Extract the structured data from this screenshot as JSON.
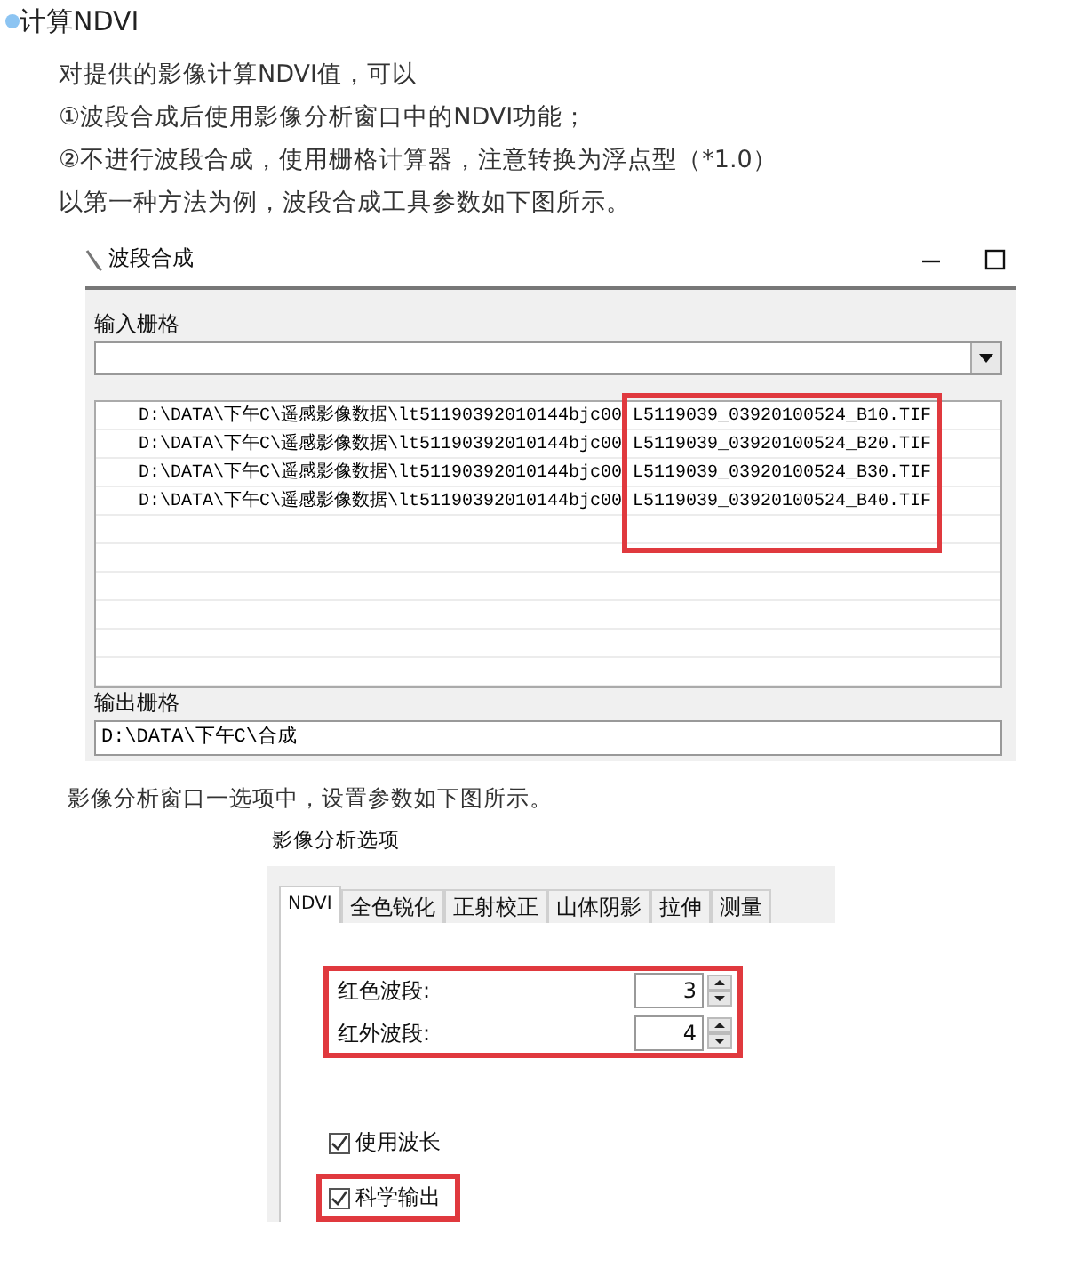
{
  "heading": {
    "text": "计算NDVI"
  },
  "paragraphs": [
    "对提供的影像计算NDVI值，可以",
    "①波段合成后使用影像分析窗口中的NDVI功能；",
    "②不进行波段合成，使用栅格计算器，注意转换为浮点型（*1.0）",
    "以第一种方法为例，波段合成工具参数如下图所示。"
  ],
  "band_window": {
    "title": "波段合成",
    "input_label": "输入栅格",
    "files_highlighted": true,
    "files": [
      {
        "folder": "D:\\DATA\\下午C\\遥感影像数据\\lt51190392010144bjc00",
        "file": "L5119039_03920100524_B10.TIF"
      },
      {
        "folder": "D:\\DATA\\下午C\\遥感影像数据\\lt51190392010144bjc00",
        "file": "L5119039_03920100524_B20.TIF"
      },
      {
        "folder": "D:\\DATA\\下午C\\遥感影像数据\\lt51190392010144bjc00",
        "file": "L5119039_03920100524_B30.TIF"
      },
      {
        "folder": "D:\\DATA\\下午C\\遥感影像数据\\lt51190392010144bjc00",
        "file": "L5119039_03920100524_B40.TIF"
      }
    ],
    "output_label": "输出栅格",
    "output_value": "D:\\DATA\\下午C\\合成"
  },
  "caption": "影像分析窗口一选项中，设置参数如下图所示。",
  "options_window": {
    "title": "影像分析选项",
    "tabs": [
      {
        "label": "NDVI",
        "selected": true
      },
      {
        "label": "全色锐化",
        "selected": false
      },
      {
        "label": "正射校正",
        "selected": false
      },
      {
        "label": "山体阴影",
        "selected": false
      },
      {
        "label": "拉伸",
        "selected": false
      },
      {
        "label": "测量",
        "selected": false
      }
    ],
    "bands_highlighted": true,
    "bands": [
      {
        "label": "红色波段:",
        "value": "3"
      },
      {
        "label": "红外波段:",
        "value": "4"
      }
    ],
    "options": [
      {
        "label": "使用波长",
        "checked": true,
        "highlighted": false
      },
      {
        "label": "科学输出",
        "checked": true,
        "highlighted": true
      }
    ]
  }
}
